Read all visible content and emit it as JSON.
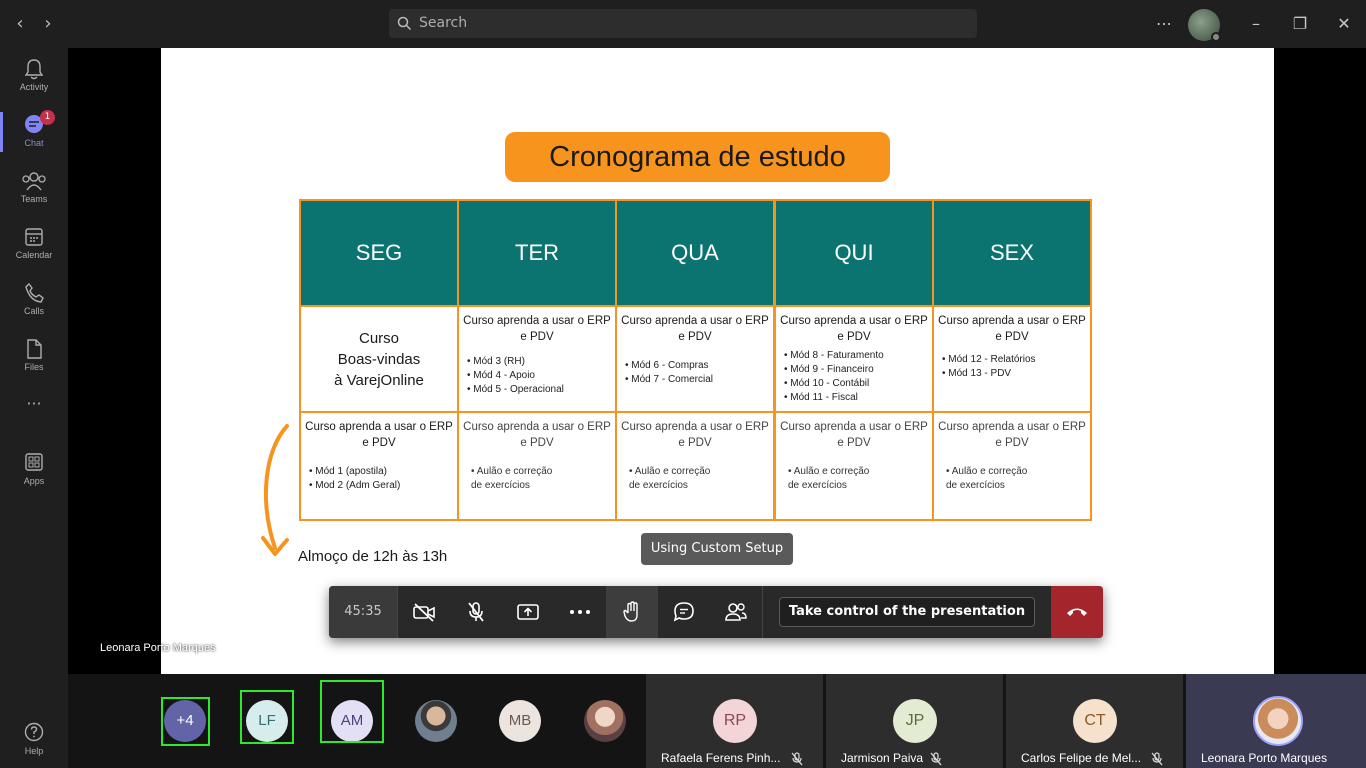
{
  "search": {
    "placeholder": "Search"
  },
  "rail": {
    "items": [
      {
        "label": "Activity",
        "icon": "bell-icon"
      },
      {
        "label": "Chat",
        "icon": "chat-icon",
        "badge": "1",
        "active": true
      },
      {
        "label": "Teams",
        "icon": "teams-icon"
      },
      {
        "label": "Calendar",
        "icon": "calendar-icon"
      },
      {
        "label": "Calls",
        "icon": "phone-icon"
      },
      {
        "label": "Files",
        "icon": "file-icon"
      },
      {
        "label": "Apps",
        "icon": "apps-icon"
      }
    ],
    "help": "Help"
  },
  "slide": {
    "title": "Cronograma de estudo",
    "days": [
      "SEG",
      "TER",
      "QUA",
      "QUI",
      "SEX"
    ],
    "row1": [
      {
        "big": "Curso\nBoas-vindas\nà VarejOnline"
      },
      {
        "title": "Curso aprenda a usar o ERP e PDV",
        "items": [
          "Mód 3 (RH)",
          "Mód 4 - Apoio",
          "Mód 5 - Operacional"
        ]
      },
      {
        "title": "Curso aprenda a usar o ERP e PDV",
        "items": [
          "Mód 6 - Compras",
          "Mód 7 - Comercial"
        ]
      },
      {
        "title": "Curso aprenda a usar o ERP e PDV",
        "items": [
          "Mód 8 - Faturamento",
          "Mód 9 - Financeiro",
          "Mód 10 - Contábil",
          "Mód 11 - Fiscal"
        ]
      },
      {
        "title": "Curso aprenda a usar o ERP e PDV",
        "items": [
          "Mód 12 - Relatórios",
          "Mód 13 - PDV"
        ]
      }
    ],
    "row2": [
      {
        "title": "Curso aprenda a usar o ERP e PDV",
        "items": [
          "Mód 1 (apostila)",
          "Mod 2 (Adm Geral)"
        ]
      },
      {
        "title": "Curso aprenda a usar o ERP e PDV",
        "sub": "• Aulão e correção\nde exercícios"
      },
      {
        "title": "Curso aprenda a usar o ERP e PDV",
        "sub": "• Aulão e correção\nde exercícios"
      },
      {
        "title": "Curso aprenda a usar o ERP e PDV",
        "sub": "• Aulão e correção\nde exercícios"
      },
      {
        "title": "Curso aprenda a usar o ERP e PDV",
        "sub": "• Aulão e correção\nde exercícios"
      }
    ],
    "lunch": "Almoço de 12h às 13h",
    "colors": {
      "header": "#0c7470",
      "accent": "#f7941d"
    }
  },
  "tooltip": "Using Custom Setup",
  "presenter": "Leonara Porto Marques",
  "controls": {
    "timer": "45:35",
    "take_control": "Take control of the presentation"
  },
  "strip": {
    "minis": [
      {
        "initials": "+4",
        "bg": "#6264a7",
        "fg": "#ffffff"
      },
      {
        "initials": "LF",
        "bg": "#d7ecec",
        "fg": "#3b6e6e"
      },
      {
        "initials": "AM",
        "bg": "#e3e0f5",
        "fg": "#4a4377"
      },
      {
        "initials": "",
        "bg": "#8a7a6a",
        "fg": "#ffffff",
        "photo": true
      },
      {
        "initials": "MB",
        "bg": "#ece4df",
        "fg": "#6a5a50"
      },
      {
        "initials": "",
        "bg": "#a08070",
        "fg": "#ffffff",
        "photo": true
      }
    ],
    "tiles": [
      {
        "initials": "RP",
        "name": "Rafaela Ferens Pinh...",
        "bg": "#f3d5d8",
        "fg": "#8a4a52"
      },
      {
        "initials": "JP",
        "name": "Jarmison Paiva",
        "bg": "#e3ecd2",
        "fg": "#5b6e3a"
      },
      {
        "initials": "CT",
        "name": "Carlos Felipe de Mel...",
        "bg": "#f6e1cc",
        "fg": "#8a5a2a"
      },
      {
        "initials": "",
        "name": "Leonara Porto Marques",
        "bg": "#c9a07a",
        "fg": "#ffffff",
        "photo": true
      }
    ]
  }
}
